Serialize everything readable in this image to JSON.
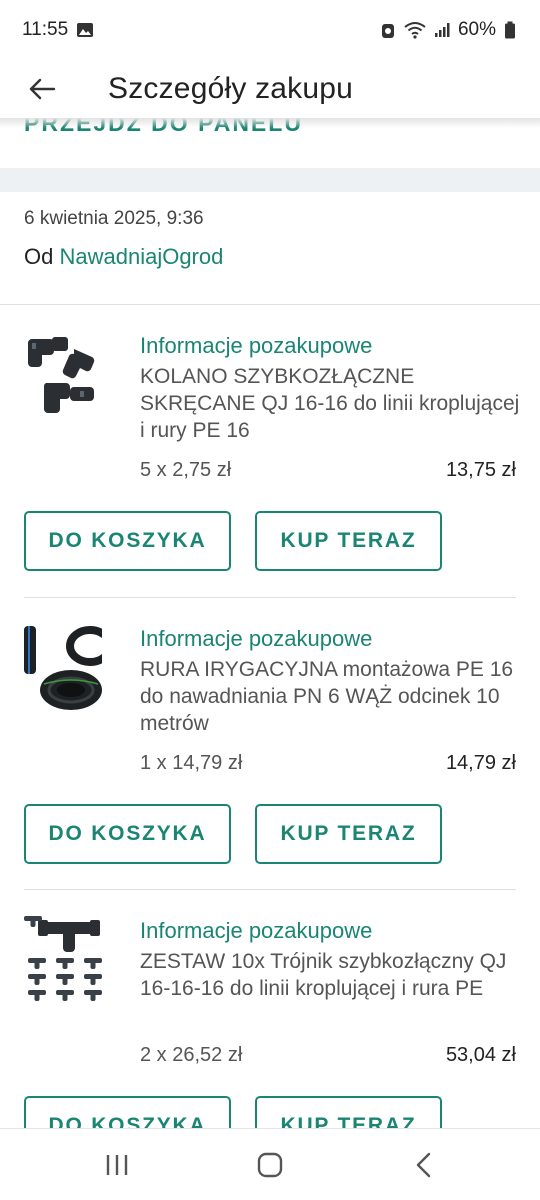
{
  "status_bar": {
    "time": "11:55",
    "battery": "60%"
  },
  "app_bar": {
    "title": "Szczegóły zakupu"
  },
  "panel_link": {
    "label": "PRZEJDŹ DO PANELU"
  },
  "order": {
    "date": "6 kwietnia 2025, 9:36",
    "seller_prefix": "Od",
    "seller_name": "NawadniajOgrod"
  },
  "products": [
    {
      "info_link": "Informacje pozakupowe",
      "title": "KOLANO SZYBKOZŁĄCZNE SKRĘCANE QJ 16-16 do linii kroplującej i rury PE 16",
      "quantity_price": "5 x 2,75 zł",
      "total": "13,75 zł",
      "cart_button": "DO KOSZYKA",
      "buy_button": "KUP TERAZ"
    },
    {
      "info_link": "Informacje pozakupowe",
      "title": "RURA IRYGACYJNA montażowa PE 16 do nawadniania PN 6 WĄŻ odcinek 10 metrów",
      "quantity_price": "1 x 14,79 zł",
      "total": "14,79 zł",
      "cart_button": "DO KOSZYKA",
      "buy_button": "KUP TERAZ"
    },
    {
      "info_link": "Informacje pozakupowe",
      "title": "ZESTAW 10x Trójnik szybkozłączny QJ 16-16-16 do linii kroplującej i rura PE",
      "quantity_price": "2 x 26,52 zł",
      "total": "53,04 zł",
      "cart_button": "DO KOSZYKA",
      "buy_button": "KUP TERAZ"
    }
  ],
  "theme": {
    "accent": "#1b8574",
    "band": "#edf1f4"
  }
}
